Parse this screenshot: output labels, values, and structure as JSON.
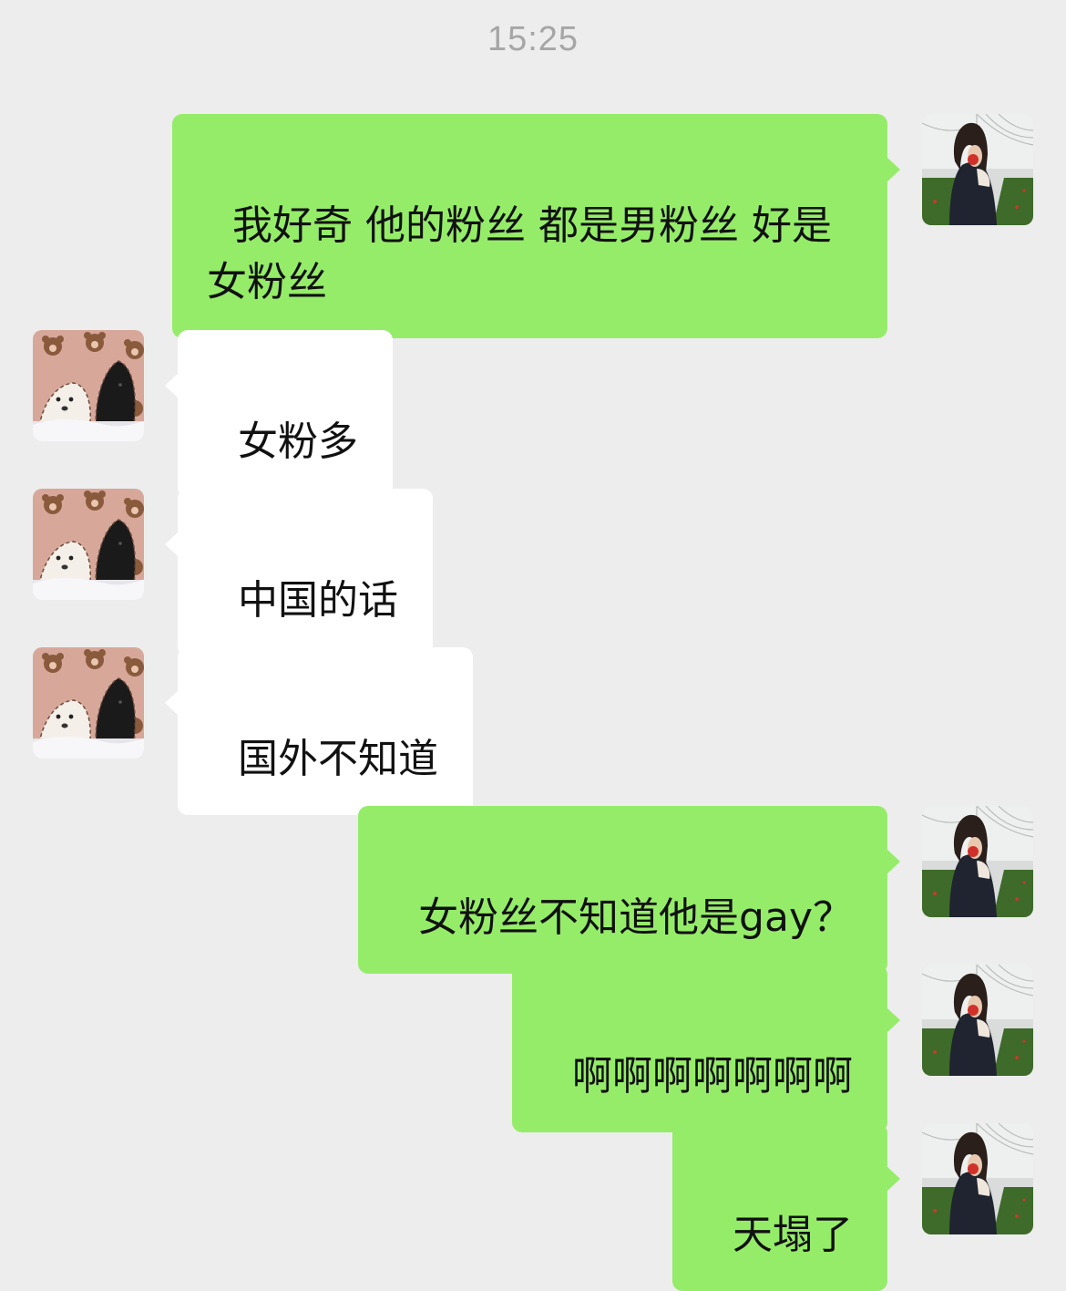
{
  "chat": {
    "timestamp": "15:25",
    "messages": [
      {
        "sender": "me",
        "text": "我好奇 他的粉丝 都是男粉丝 好是女粉丝",
        "avatar": "user-photo-avatar"
      },
      {
        "sender": "friend",
        "text": "女粉多",
        "avatar": "dogs-avatar"
      },
      {
        "sender": "friend",
        "text": "中国的话",
        "avatar": "dogs-avatar"
      },
      {
        "sender": "friend",
        "text": "国外不知道",
        "avatar": "dogs-avatar"
      },
      {
        "sender": "me",
        "text": "女粉丝不知道他是gay？",
        "avatar": "user-photo-avatar"
      },
      {
        "sender": "me",
        "text": "啊啊啊啊啊啊啊",
        "avatar": "user-photo-avatar"
      },
      {
        "sender": "me",
        "text": "天塌了",
        "avatar": "user-photo-avatar"
      }
    ]
  },
  "colors": {
    "background": "#ededed",
    "outgoing_bubble": "#95ec69",
    "incoming_bubble": "#ffffff",
    "timestamp_text": "#a6a6a6"
  }
}
